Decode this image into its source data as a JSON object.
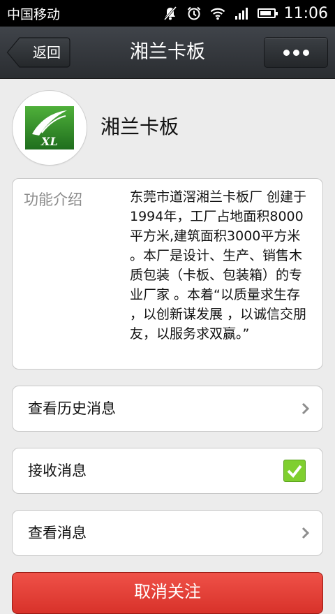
{
  "status_bar": {
    "carrier": "中国移动",
    "time": "11:06",
    "icons": [
      "mute-icon",
      "alarm-icon",
      "wifi-icon",
      "signal-icon",
      "battery-icon"
    ],
    "battery_level": 0.85
  },
  "title_bar": {
    "back_label": "返回",
    "title": "湘兰卡板",
    "more_icon": "more-dots-icon"
  },
  "profile": {
    "name": "湘兰卡板",
    "logo_text": "XL",
    "logo_color": "#2e8b2a"
  },
  "intro": {
    "label": "功能介绍",
    "text": "东莞市道滘湘兰卡板厂 创建于1994年，工厂占地面积8000平方米,建筑面积3000平方米 。本厂是设计、生产、销售木质包装（卡板、包装箱）的专业厂家 。本着“以质量求生存 ，以创新谋发展 ，以诚信交朋友，以服务求双赢。”"
  },
  "menu": {
    "history": "查看历史消息",
    "receive": "接收消息",
    "receive_checked": true,
    "view": "查看消息"
  },
  "actions": {
    "unfollow": "取消关注",
    "unfollow_color": "#e0392f"
  }
}
